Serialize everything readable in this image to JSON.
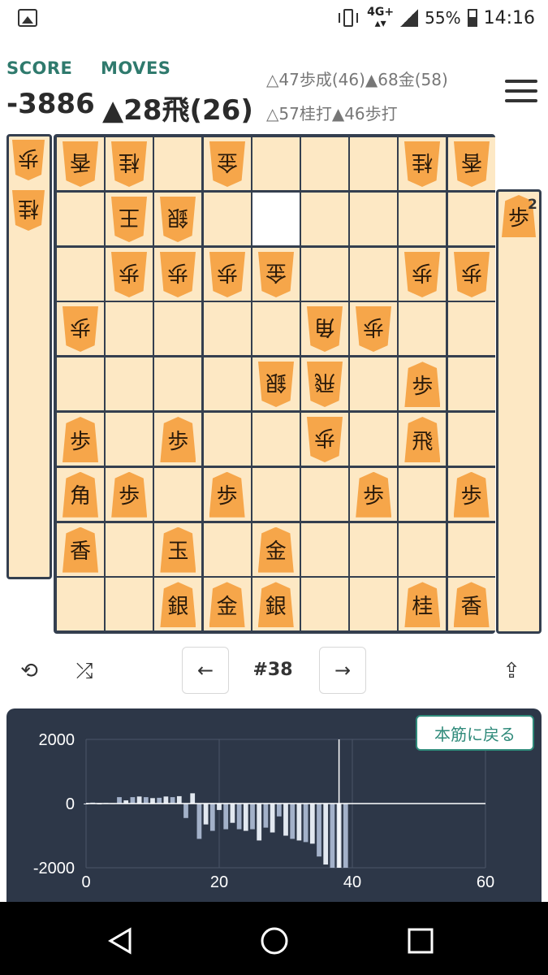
{
  "statusbar": {
    "network": "4G+",
    "battery": "55%",
    "time": "14:16"
  },
  "header": {
    "score_label": "SCORE",
    "moves_label": "MOVES",
    "score_value": "-3886",
    "current_move": "▲28飛(26)",
    "history": [
      "△47歩成(46)▲68金(58)",
      "△57桂打▲46歩打"
    ]
  },
  "hands": {
    "gote": [
      {
        "piece": "歩"
      },
      {
        "piece": "桂"
      }
    ],
    "sente": [
      {
        "piece": "歩",
        "count": "2"
      }
    ]
  },
  "board": {
    "highlight": [
      {
        "row": 1,
        "col": 4
      }
    ],
    "pieces": [
      {
        "row": 0,
        "col": 0,
        "piece": "香",
        "side": "gote"
      },
      {
        "row": 0,
        "col": 1,
        "piece": "桂",
        "side": "gote"
      },
      {
        "row": 0,
        "col": 3,
        "piece": "金",
        "side": "gote"
      },
      {
        "row": 0,
        "col": 7,
        "piece": "桂",
        "side": "gote"
      },
      {
        "row": 0,
        "col": 8,
        "piece": "香",
        "side": "gote"
      },
      {
        "row": 1,
        "col": 1,
        "piece": "王",
        "side": "gote"
      },
      {
        "row": 1,
        "col": 2,
        "piece": "銀",
        "side": "gote"
      },
      {
        "row": 2,
        "col": 1,
        "piece": "歩",
        "side": "gote"
      },
      {
        "row": 2,
        "col": 2,
        "piece": "歩",
        "side": "gote"
      },
      {
        "row": 2,
        "col": 3,
        "piece": "歩",
        "side": "gote"
      },
      {
        "row": 2,
        "col": 4,
        "piece": "金",
        "side": "gote"
      },
      {
        "row": 2,
        "col": 7,
        "piece": "歩",
        "side": "gote"
      },
      {
        "row": 2,
        "col": 8,
        "piece": "歩",
        "side": "gote"
      },
      {
        "row": 3,
        "col": 0,
        "piece": "歩",
        "side": "gote"
      },
      {
        "row": 3,
        "col": 5,
        "piece": "角",
        "side": "gote"
      },
      {
        "row": 3,
        "col": 6,
        "piece": "歩",
        "side": "gote"
      },
      {
        "row": 4,
        "col": 4,
        "piece": "銀",
        "side": "gote"
      },
      {
        "row": 4,
        "col": 5,
        "piece": "飛",
        "side": "gote"
      },
      {
        "row": 4,
        "col": 7,
        "piece": "歩",
        "side": "sente"
      },
      {
        "row": 5,
        "col": 0,
        "piece": "歩",
        "side": "sente"
      },
      {
        "row": 5,
        "col": 2,
        "piece": "歩",
        "side": "sente"
      },
      {
        "row": 5,
        "col": 5,
        "piece": "歩",
        "side": "gote"
      },
      {
        "row": 5,
        "col": 7,
        "piece": "飛",
        "side": "sente"
      },
      {
        "row": 6,
        "col": 0,
        "piece": "角",
        "side": "sente"
      },
      {
        "row": 6,
        "col": 1,
        "piece": "歩",
        "side": "sente"
      },
      {
        "row": 6,
        "col": 3,
        "piece": "歩",
        "side": "sente"
      },
      {
        "row": 6,
        "col": 6,
        "piece": "歩",
        "side": "sente"
      },
      {
        "row": 6,
        "col": 8,
        "piece": "歩",
        "side": "sente"
      },
      {
        "row": 7,
        "col": 0,
        "piece": "香",
        "side": "sente"
      },
      {
        "row": 7,
        "col": 2,
        "piece": "玉",
        "side": "sente"
      },
      {
        "row": 7,
        "col": 4,
        "piece": "金",
        "side": "sente"
      },
      {
        "row": 8,
        "col": 2,
        "piece": "銀",
        "side": "sente"
      },
      {
        "row": 8,
        "col": 3,
        "piece": "金",
        "side": "sente"
      },
      {
        "row": 8,
        "col": 4,
        "piece": "銀",
        "side": "sente"
      },
      {
        "row": 8,
        "col": 7,
        "piece": "桂",
        "side": "sente"
      },
      {
        "row": 8,
        "col": 8,
        "piece": "香",
        "side": "sente"
      }
    ]
  },
  "controls": {
    "move_number": "#38",
    "prev": "←",
    "next": "→"
  },
  "back_button": "本筋に戻る",
  "chart_data": {
    "type": "bar",
    "xlim": [
      0,
      60
    ],
    "ylim": [
      -2000,
      2000
    ],
    "xticks": [
      "0",
      "20",
      "40",
      "60"
    ],
    "yticks": [
      "2000",
      "0",
      "-2000"
    ],
    "current_move": 38,
    "grid": true,
    "series": [
      {
        "values": [
          0,
          30,
          0,
          20,
          10,
          200,
          100,
          200,
          220,
          200,
          170,
          180,
          220,
          200,
          230,
          -450,
          320,
          -1100,
          -650,
          -850,
          -200,
          -800,
          -600,
          -800,
          -850,
          -800,
          -1150,
          -750,
          -900,
          -400,
          -1000,
          -1100,
          -1150,
          -1200,
          -1250,
          -1650,
          -1900,
          -2000,
          -2000,
          -2000
        ]
      }
    ]
  },
  "colors": {
    "board_bg": "#fde8c4",
    "grid": "#343f4f",
    "piece": "#f6a64a",
    "accent": "#2f7a6d",
    "chart_bg": "#2d3748"
  }
}
